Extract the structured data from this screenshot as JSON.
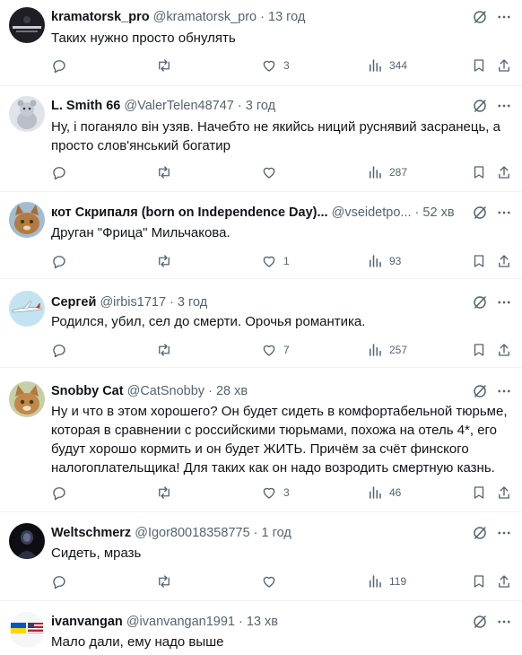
{
  "posts": [
    {
      "name": "kramatorsk_pro",
      "handle": "@kramatorsk_pro",
      "time": "13 год",
      "text_lines": [
        "Таких нужно просто обнулять"
      ],
      "replies": "",
      "reposts": "",
      "likes": "3",
      "views": "344",
      "avatar": "kramatorsk-avatar"
    },
    {
      "name": "L. Smith 66",
      "handle": "@ValerTelen48747",
      "time": "3 год",
      "text_lines": [
        "Ну, і поганяло він узяв. Начебто не якийсь ниций руснявий засранець, а",
        "просто слов'янський богатир"
      ],
      "replies": "",
      "reposts": "",
      "likes": "",
      "views": "287",
      "avatar": "plush-toy-avatar"
    },
    {
      "name": "кот Скрипаля (born on Independence Day)...",
      "handle": "@vseidetpo...",
      "time": "52 хв",
      "text_lines": [
        "Друган \"Фрица\" Мильчакова."
      ],
      "replies": "",
      "reposts": "",
      "likes": "1",
      "views": "93",
      "avatar": "cat-avatar"
    },
    {
      "name": "Сергей",
      "handle": "@irbis1717",
      "time": "3 год",
      "text_lines": [
        "Родился, убил, сел до смерти. Орочья романтика."
      ],
      "replies": "",
      "reposts": "",
      "likes": "7",
      "views": "257",
      "avatar": "airplane-avatar"
    },
    {
      "name": "Snobby Cat",
      "handle": "@CatSnobby",
      "time": "28 хв",
      "text_lines": [
        "Ну и что в этом хорошего? Он будет сидеть в комфортабельной тюрьме,",
        "которая в сравнении с российскими тюрьмами, похожа на отель 4*, его",
        "будут хорошо кормить и он будет ЖИТЬ. Причём за счёт финского",
        "налогоплательщика! Для таких как он надо возродить смертную казнь."
      ],
      "replies": "",
      "reposts": "",
      "likes": "3",
      "views": "46",
      "avatar": "snobby-cat-avatar"
    },
    {
      "name": "Weltschmerz",
      "handle": "@Igor80018358775",
      "time": "1 год",
      "text_lines": [
        "Сидеть, мразь"
      ],
      "replies": "",
      "reposts": "",
      "likes": "",
      "views": "119",
      "avatar": "dark-figure-avatar"
    },
    {
      "name": "ivanvangan",
      "handle": "@ivanvangan1991",
      "time": "13 хв",
      "text_lines": [
        "Мало дали, ему надо выше"
      ],
      "replies": "",
      "reposts": "",
      "likes": "",
      "views": "",
      "avatar": "flags-avatar"
    }
  ],
  "separator": "·",
  "icons": [
    "grok-icon",
    "more-icon",
    "reply-icon",
    "repost-icon",
    "like-icon",
    "views-icon",
    "bookmark-icon",
    "share-icon"
  ],
  "colors": {
    "text": "#0f1419",
    "secondary": "#536471",
    "divider": "#eff3f4",
    "background": "#ffffff"
  }
}
